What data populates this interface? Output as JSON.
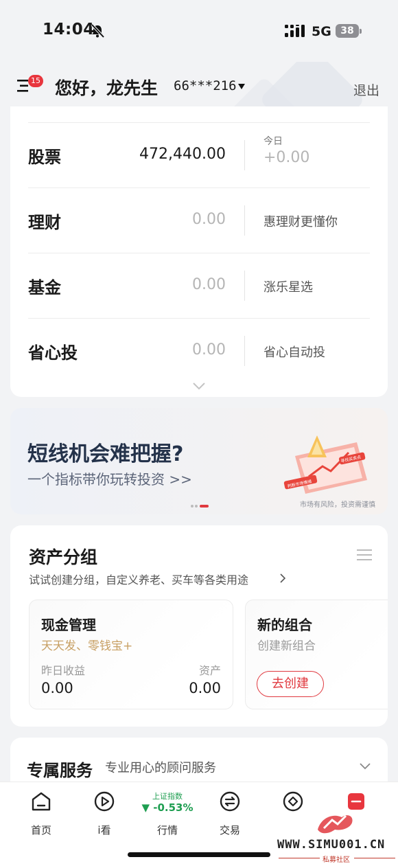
{
  "status_bar": {
    "time": "14:04",
    "network": "5G",
    "battery": "38"
  },
  "header": {
    "badge_count": "15",
    "greeting": "您好，龙先生",
    "account": "66***216",
    "logout": "退出"
  },
  "assets": {
    "rows": [
      {
        "name": "股票",
        "value": "472,440.00",
        "today_label": "今日",
        "today_value": "+0.00"
      },
      {
        "name": "理财",
        "value": "0.00",
        "note": "惠理财更懂你"
      },
      {
        "name": "基金",
        "value": "0.00",
        "note": "涨乐星选"
      },
      {
        "name": "省心投",
        "value": "0.00",
        "note": "省心自动投"
      }
    ]
  },
  "banner": {
    "title": "短线机会难把握?",
    "subtitle": "一个指标带你玩转投资 >>",
    "risk_note": "市场有风险，投资需谨慎",
    "art_label_1": "判断市场情绪",
    "art_label_2": "寻找买卖点"
  },
  "groups": {
    "title": "资产分组",
    "subtitle": "试试创建分组，自定义养老、买车等各类用途",
    "tiles": [
      {
        "title": "现金管理",
        "subtitle": "天天发、零钱宝+",
        "left_label": "昨日收益",
        "right_label": "资产",
        "left_value": "0.00",
        "right_value": "0.00"
      },
      {
        "title": "新的组合",
        "subtitle": "创建新组合",
        "button": "去创建"
      }
    ]
  },
  "services": {
    "title": "专属服务",
    "subtitle": "专业用心的顾问服务"
  },
  "tabbar": {
    "tabs": [
      {
        "label": "首页",
        "icon": "home-icon"
      },
      {
        "label": "i看",
        "icon": "play-icon"
      },
      {
        "label": "行情",
        "index_name": "上证指数",
        "index_change": "▼ -0.53%"
      },
      {
        "label": "交易",
        "icon": "trade-icon"
      },
      {
        "label": "",
        "icon": "discover-icon"
      },
      {
        "label": "",
        "icon": "profile-icon"
      }
    ]
  },
  "watermark": {
    "text": "WWW.SIMU001.CN",
    "sub": "私募社区"
  },
  "colors": {
    "accent_red": "#e0393f",
    "gold": "#c8a064",
    "down_green": "#1f9e51"
  }
}
